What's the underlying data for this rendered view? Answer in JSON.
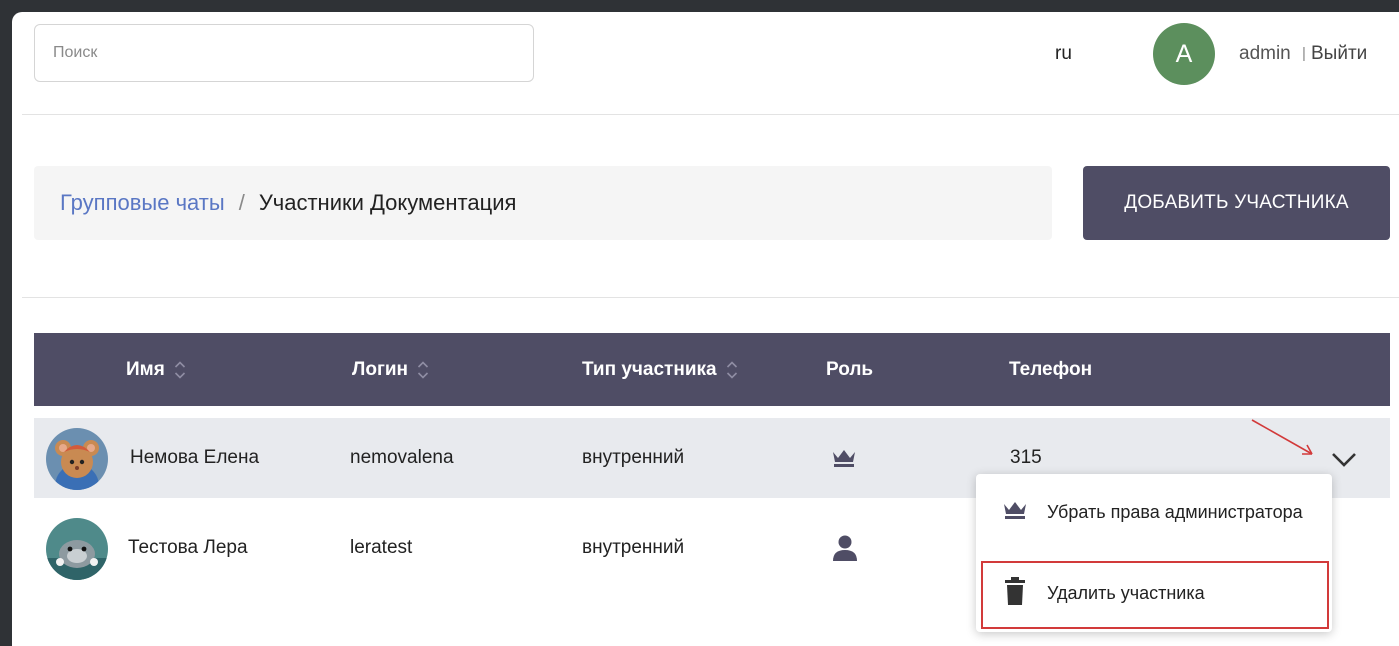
{
  "header": {
    "search_placeholder": "Поиск",
    "language": "ru",
    "avatar_letter": "A",
    "username": "admin",
    "separator": "|",
    "logout": "Выйти"
  },
  "breadcrumb": {
    "parent": "Групповые чаты",
    "separator": "/",
    "current": "Участники Документация"
  },
  "add_button": "ДОБАВИТЬ УЧАСТНИКА",
  "table": {
    "columns": {
      "name": "Имя",
      "login": "Логин",
      "type": "Тип участника",
      "role": "Роль",
      "phone": "Телефон"
    },
    "rows": [
      {
        "name": "Немова Елена",
        "login": "nemovalena",
        "type": "внутренний",
        "role_icon": "crown-icon",
        "phone": "315"
      },
      {
        "name": "Тестова Лера",
        "login": "leratest",
        "type": "внутренний",
        "role_icon": "person-icon",
        "phone": ""
      }
    ]
  },
  "menu": {
    "items": [
      {
        "label": "Убрать права администратора",
        "icon": "crown-icon"
      },
      {
        "label": "Удалить участника",
        "icon": "trash-icon"
      }
    ]
  },
  "colors": {
    "header_bg": "#4f4d65",
    "link": "#5a77c4",
    "avatar": "#5c8f5d",
    "highlight": "#d23a3a"
  }
}
